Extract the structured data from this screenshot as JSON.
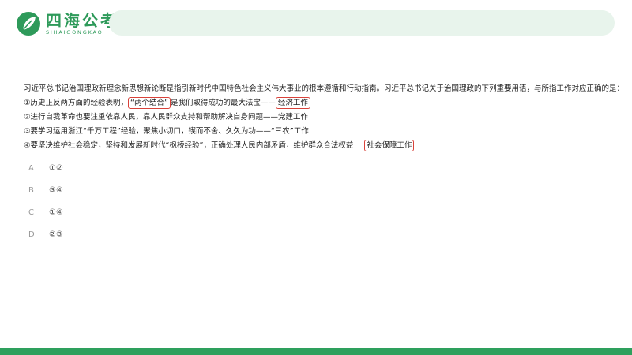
{
  "header": {
    "logo_title": "四海公考",
    "logo_subtitle": "SIHAIGONGKAO"
  },
  "question": {
    "stem": "习近平总书记治国理政新理念新思想新论断是指引新时代中国特色社会主义伟大事业的根本遵循和行动指南。习近平总书记关于治国理政的下列重要用语，与所指工作对应正确的是：",
    "items": [
      {
        "pre": "①历史正反两方面的经验表明，",
        "boxed": "“两个结合”",
        "mid": "是我们取得成功的最大法宝——",
        "answer": "经济工作"
      },
      {
        "text": "②进行自我革命也要注重依靠人民，靠人民群众支持和帮助解决自身问题——党建工作"
      },
      {
        "text": "③要学习运用浙江“千万工程”经验，聚焦小切口，锲而不舍、久久为功——“三农”工作"
      },
      {
        "pre": "④要坚决维护社会稳定，坚持和发展新时代“枫桥经验”，正确处理人民内部矛盾，维护群众合法权益",
        "answer": "社会保障工作"
      }
    ]
  },
  "options": [
    {
      "letter": "A",
      "text": "①②"
    },
    {
      "letter": "B",
      "text": "③④"
    },
    {
      "letter": "C",
      "text": "①④"
    },
    {
      "letter": "D",
      "text": "②③"
    }
  ],
  "colors": {
    "brand": "#2e9a5a",
    "highlight_box": "#d9423a",
    "footer": "#2ea05d"
  }
}
